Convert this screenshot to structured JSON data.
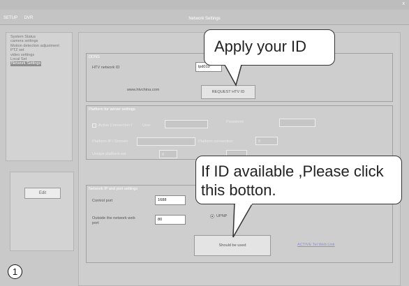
{
  "window": {
    "title": "Network Settings",
    "menu": [
      "SETUP",
      "DVR"
    ],
    "close_glyph": "x"
  },
  "sidebar": {
    "items": [
      {
        "label": "System Status"
      },
      {
        "label": "camera settings"
      },
      {
        "label": "Motion detection adjustment"
      },
      {
        "label": "PTZ set"
      },
      {
        "label": "video settings"
      },
      {
        "label": "Local Set"
      },
      {
        "label": "Network Settings",
        "selected": true
      }
    ]
  },
  "edit_button": "Edit",
  "step_number": "1",
  "ddns": {
    "title": "DDNS",
    "network_id_label": "HTV network ID",
    "network_id_value": "lpd019",
    "website": "www.htvchina.com",
    "request_button": "REQUEST HTV ID"
  },
  "platform": {
    "title": "Platform for server settings",
    "active_connection_label": "Active Connection I",
    "user_label": "User",
    "password_label": "Password",
    "platform_ip_label": "Platform IP / Domain",
    "platform_port_label": "Platform connection",
    "port_value": "0",
    "unique_id_label": "Unique platform set",
    "unique_id_value": "0"
  },
  "network": {
    "title": "Network IP and port settings",
    "control_port_label": "Control port",
    "control_port_value": "1688",
    "web_port_label": "Outside the network web port",
    "web_port_value": "80",
    "upnp_label": "UPNP",
    "should_be_used_button": "Should be used",
    "link_text": "ACTIVE Tel Web Link"
  },
  "annotations": {
    "apply_callout": "Apply your ID",
    "available_callout": "If ID available ,Please click this botton."
  }
}
